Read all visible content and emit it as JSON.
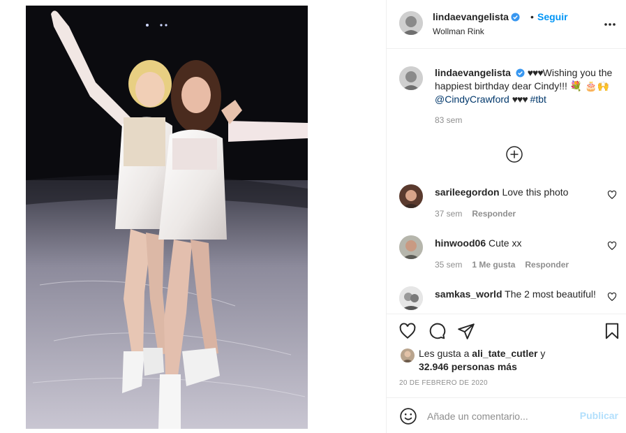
{
  "post": {
    "image_alt": "",
    "header": {
      "username": "lindaevangelista",
      "follow_label": "Seguir",
      "dot": "•",
      "location": "Wollman Rink"
    },
    "caption": {
      "username": "lindaevangelista",
      "hearts_1": "♥♥♥",
      "text_1": "Wishing you the happiest birthday dear Cindy!!! 💐",
      "emoji_2": "🎂🙌",
      "mention": "@CindyCrawford",
      "hearts_2": "♥♥♥",
      "hashtag": "#tbt",
      "time": "83 sem"
    },
    "comments": [
      {
        "username": "sarileegordon",
        "text": "Love this photo",
        "time": "37 sem",
        "likes": "",
        "reply_label": "Responder"
      },
      {
        "username": "hinwood06",
        "text": "Cute xx",
        "time": "35 sem",
        "likes": "1 Me gusta",
        "reply_label": "Responder"
      },
      {
        "username": "samkas_world",
        "text": "The 2 most beautiful!",
        "time": "",
        "likes": "",
        "reply_label": ""
      }
    ],
    "likes": {
      "prefix": "Les gusta a",
      "first_user": "ali_tate_cutler",
      "conjunction": "y",
      "others": "32.946 personas más"
    },
    "date": "20 DE FEBRERO DE 2020",
    "comment_box": {
      "placeholder": "Añade un comentario...",
      "publish_label": "Publicar"
    }
  },
  "colors": {
    "accent": "#0095f6",
    "link": "#00376b",
    "muted": "#8e8e8e",
    "publish_disabled": "#b2dffc",
    "verified": "#3897f0"
  },
  "icons": [
    "verified-badge-icon",
    "more-options-icon",
    "load-more-comments-icon",
    "comment-heart-icon",
    "like-heart-icon",
    "comment-bubble-icon",
    "share-paper-plane-icon",
    "save-bookmark-icon",
    "emoji-smiley-icon"
  ]
}
